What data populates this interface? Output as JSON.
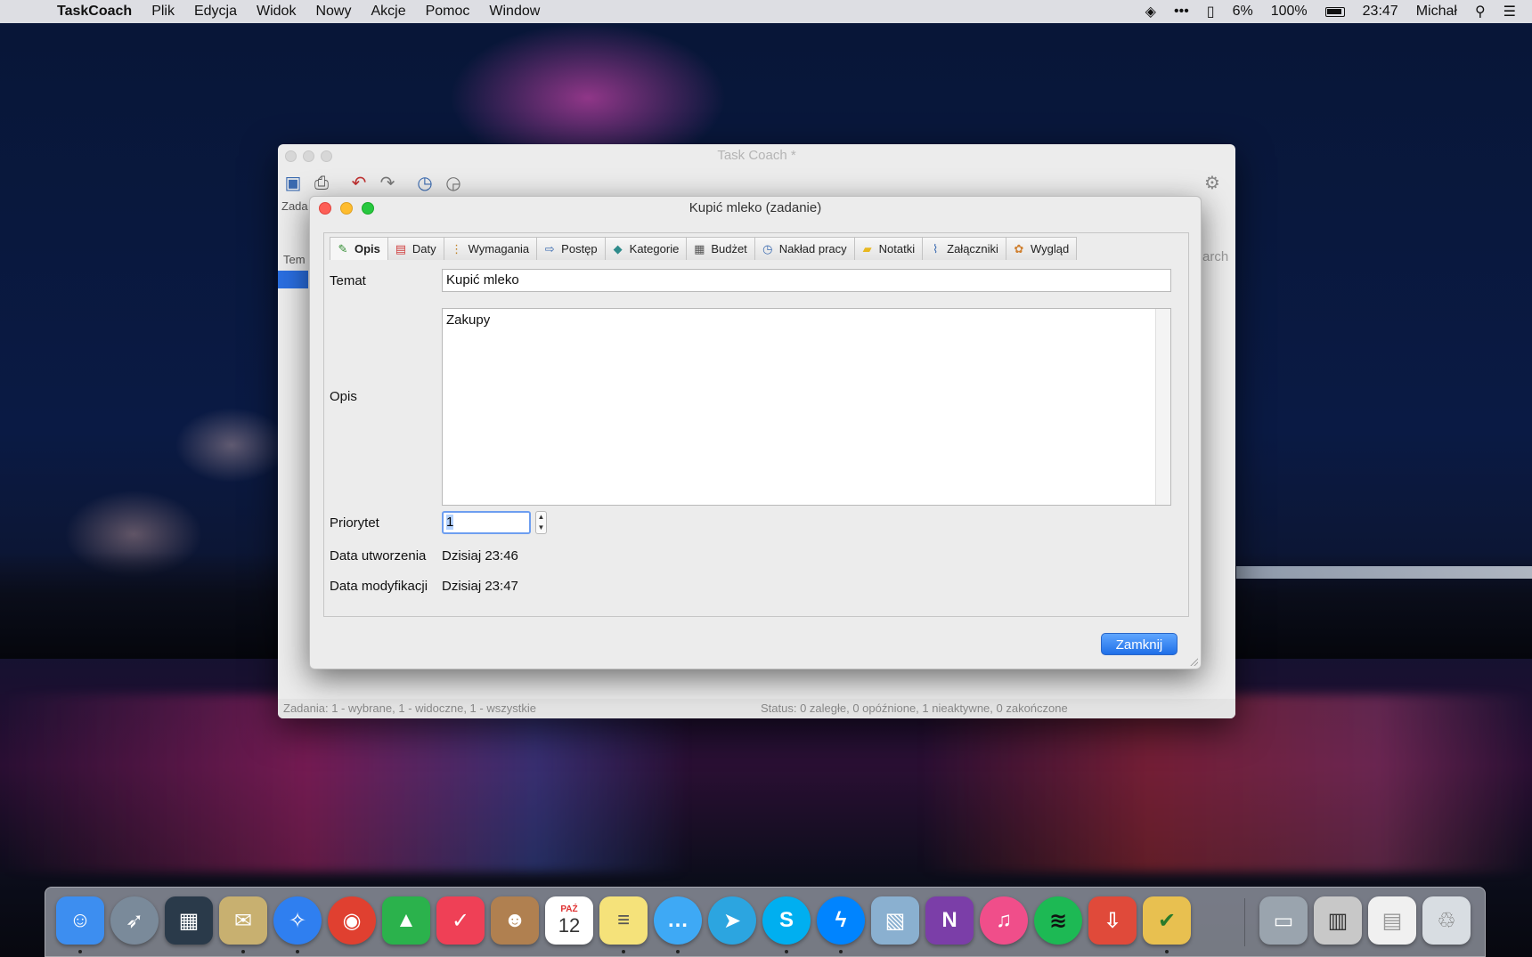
{
  "menubar": {
    "app_name": "TaskCoach",
    "menus": [
      "Plik",
      "Edycja",
      "Widok",
      "Nowy",
      "Akcje",
      "Pomoc",
      "Window"
    ],
    "battery_small": "6%",
    "battery_main": "100%",
    "clock": "23:47",
    "user": "Michał"
  },
  "main_window": {
    "title": "Task Coach *",
    "fragments": {
      "tab": "Zada",
      "column": "Tem",
      "search": "arch"
    },
    "status_left": "Zadania: 1 - wybrane, 1 - widoczne, 1 - wszystkie",
    "status_right": "Status: 0 zaległe, 0 opóźnione, 1 nieaktywne, 0 zakończone"
  },
  "dialog": {
    "title": "Kupić mleko (zadanie)",
    "tabs": [
      {
        "label": "Opis",
        "icon": "pencil-icon",
        "color": "#2e8b2e"
      },
      {
        "label": "Daty",
        "icon": "calendar-icon",
        "color": "#d04040"
      },
      {
        "label": "Wymagania",
        "icon": "traffic-light-icon",
        "color": "#c08020"
      },
      {
        "label": "Postęp",
        "icon": "progress-arrow-icon",
        "color": "#3a6ab0"
      },
      {
        "label": "Kategorie",
        "icon": "folder-cube-icon",
        "color": "#2e8b8b"
      },
      {
        "label": "Budżet",
        "icon": "calculator-icon",
        "color": "#555555"
      },
      {
        "label": "Nakład pracy",
        "icon": "clock-icon",
        "color": "#3a6ab0"
      },
      {
        "label": "Notatki",
        "icon": "note-icon",
        "color": "#e8b820"
      },
      {
        "label": "Załączniki",
        "icon": "paperclip-icon",
        "color": "#3a6ab0"
      },
      {
        "label": "Wygląd",
        "icon": "palette-icon",
        "color": "#d08030"
      }
    ],
    "fields": {
      "subject_label": "Temat",
      "subject_value": "Kupić mleko",
      "description_label": "Opis",
      "description_value": "Zakupy",
      "priority_label": "Priorytet",
      "priority_value": "1",
      "created_label": "Data utworzenia",
      "created_value": "Dzisiaj 23:46",
      "modified_label": "Data modyfikacji",
      "modified_value": "Dzisiaj 23:47"
    },
    "close_button": "Zamknij"
  },
  "dock": {
    "calendar_month": "PAŹ",
    "calendar_day": "12",
    "apps": [
      {
        "name": "finder-icon",
        "color": "#3d8ef0"
      },
      {
        "name": "launchpad-icon",
        "color": "#7a8a9a"
      },
      {
        "name": "mission-control-icon",
        "color": "#2a3a4a"
      },
      {
        "name": "mail-stamp-icon",
        "color": "#c8b070"
      },
      {
        "name": "safari-icon",
        "color": "#2f7ff0"
      },
      {
        "name": "chrome-icon",
        "color": "#e04030"
      },
      {
        "name": "feedly-icon",
        "color": "#2bb24c"
      },
      {
        "name": "pocket-icon",
        "color": "#ef4056"
      },
      {
        "name": "contacts-icon",
        "color": "#b08050"
      },
      {
        "name": "calendar-icon",
        "color": "#ffffff"
      },
      {
        "name": "notes-icon",
        "color": "#f5e27a"
      },
      {
        "name": "messages-icon",
        "color": "#3ea9f5"
      },
      {
        "name": "telegram-icon",
        "color": "#2ca5e0"
      },
      {
        "name": "skype-icon",
        "color": "#00aff0"
      },
      {
        "name": "messenger-icon",
        "color": "#0084ff"
      },
      {
        "name": "preview-icon",
        "color": "#8ab0d0"
      },
      {
        "name": "onenote-icon",
        "color": "#7b3ea8"
      },
      {
        "name": "itunes-icon",
        "color": "#f04e8a"
      },
      {
        "name": "spotify-icon",
        "color": "#1db954"
      },
      {
        "name": "downloader-icon",
        "color": "#e04a3a"
      },
      {
        "name": "taskcoach-icon",
        "color": "#e8c050"
      },
      {
        "name": "folder-icon",
        "color": "#9aa4ae"
      },
      {
        "name": "screenshots-icon",
        "color": "#c8c8c8"
      },
      {
        "name": "documents-icon",
        "color": "#f0f0f0"
      },
      {
        "name": "trash-icon",
        "color": "#d8dde2"
      }
    ]
  }
}
